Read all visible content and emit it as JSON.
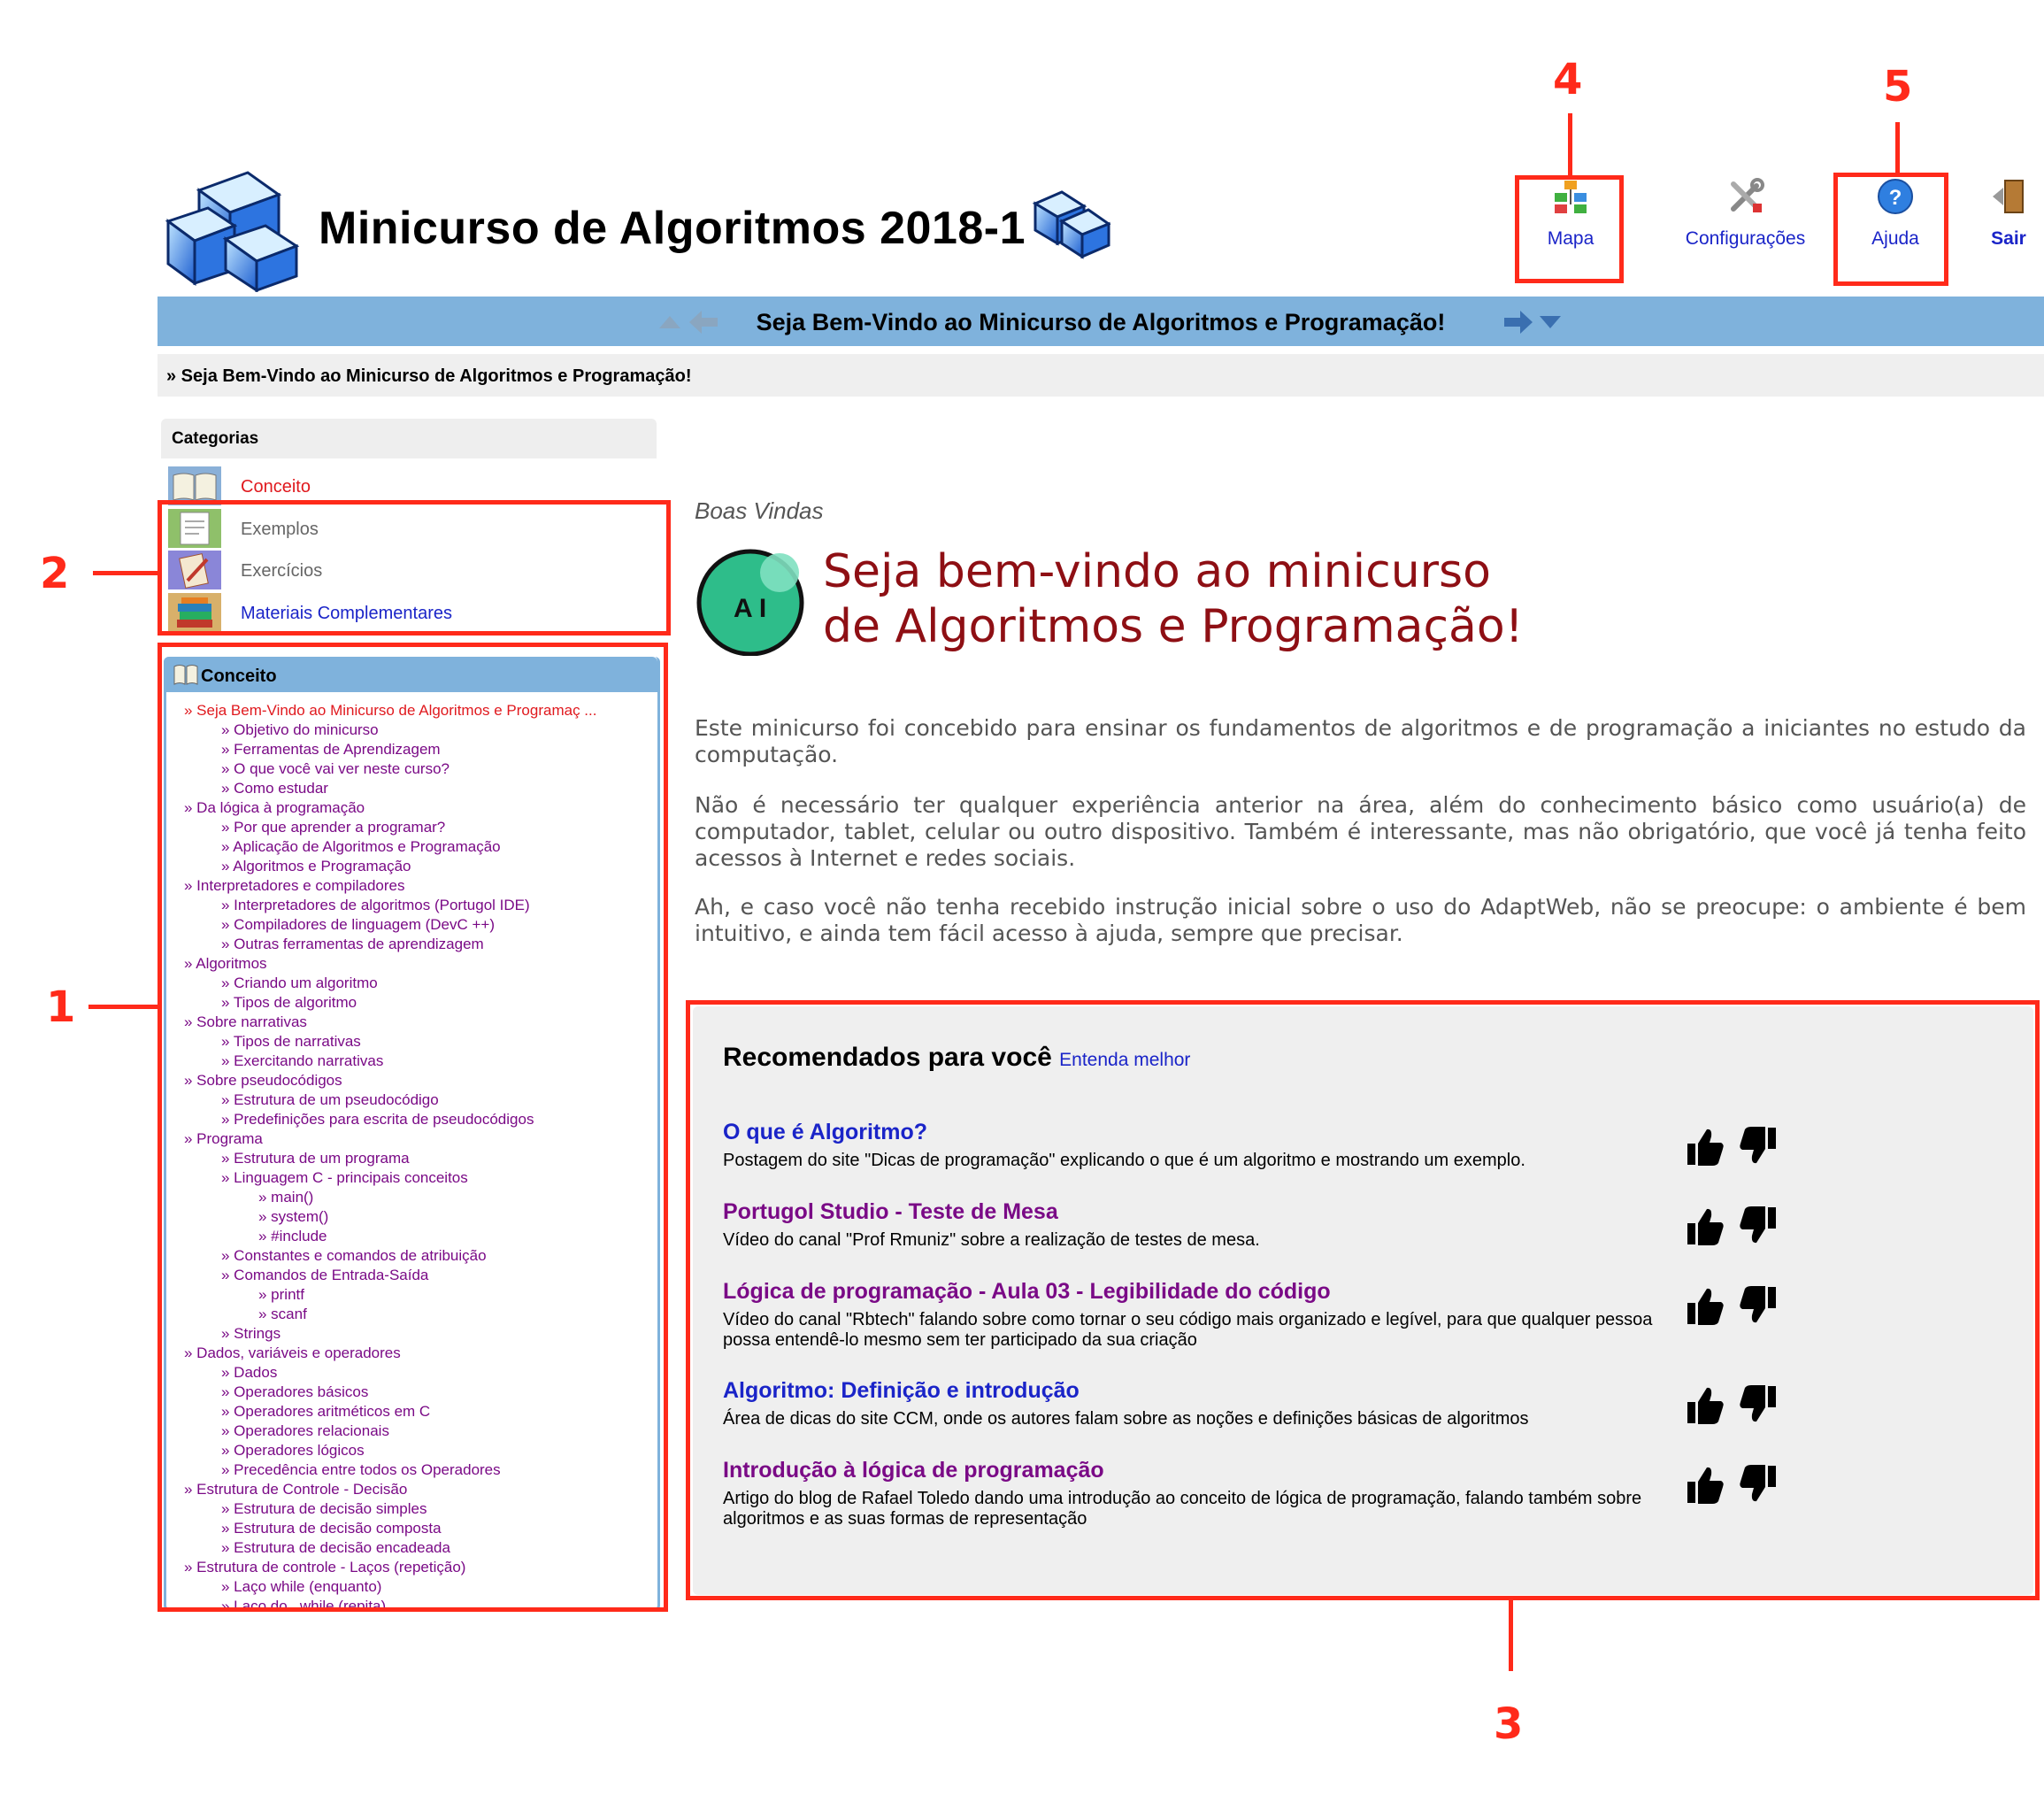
{
  "header": {
    "title": "Minicurso de Algoritmos 2018-1",
    "nav": [
      {
        "label": "Mapa",
        "icon": "sitemap-icon"
      },
      {
        "label": "Configurações",
        "icon": "tools-icon"
      },
      {
        "label": "Ajuda",
        "icon": "help-icon"
      },
      {
        "label": "Sair",
        "icon": "exit-door-icon"
      }
    ]
  },
  "banner": {
    "text": "Seja Bem-Vindo ao Minicurso de Algoritmos e Programação!",
    "breadcrumb": "» Seja Bem-Vindo ao Minicurso de Algoritmos e Programação!"
  },
  "categories": {
    "title": "Categorias",
    "items": [
      {
        "label": "Conceito",
        "color": "#e0191e"
      },
      {
        "label": "Exemplos",
        "color": "#666666"
      },
      {
        "label": "Exercícios",
        "color": "#666666"
      },
      {
        "label": "Materiais Complementares",
        "color": "#1a24c8"
      }
    ]
  },
  "tree": {
    "title": "Conceito",
    "items": [
      {
        "text": "» Seja Bem-Vindo ao Minicurso de Algoritmos e Programaç ...",
        "level": 0,
        "active": true
      },
      {
        "text": "» Objetivo do minicurso",
        "level": 1
      },
      {
        "text": "» Ferramentas de Aprendizagem",
        "level": 1
      },
      {
        "text": "» O que você vai ver neste curso?",
        "level": 1
      },
      {
        "text": "» Como estudar",
        "level": 1
      },
      {
        "text": "» Da lógica à programação",
        "level": 0
      },
      {
        "text": "» Por que aprender a programar?",
        "level": 1
      },
      {
        "text": "» Aplicação de Algoritmos e Programação",
        "level": 1
      },
      {
        "text": "» Algoritmos e Programação",
        "level": 1
      },
      {
        "text": "» Interpretadores e compiladores",
        "level": 0
      },
      {
        "text": "» Interpretadores de algoritmos (Portugol IDE)",
        "level": 1
      },
      {
        "text": "» Compiladores de linguagem (DevC ++)",
        "level": 1
      },
      {
        "text": "» Outras ferramentas de aprendizagem",
        "level": 1
      },
      {
        "text": "» Algoritmos",
        "level": 0
      },
      {
        "text": "» Criando um algoritmo",
        "level": 1
      },
      {
        "text": "» Tipos de algoritmo",
        "level": 1
      },
      {
        "text": "» Sobre narrativas",
        "level": 0
      },
      {
        "text": "» Tipos de narrativas",
        "level": 1
      },
      {
        "text": "» Exercitando narrativas",
        "level": 1
      },
      {
        "text": "» Sobre pseudocódigos",
        "level": 0
      },
      {
        "text": "» Estrutura de um pseudocódigo",
        "level": 1
      },
      {
        "text": "» Predefinições para escrita de pseudocódigos",
        "level": 1
      },
      {
        "text": "» Programa",
        "level": 0
      },
      {
        "text": "» Estrutura de um programa",
        "level": 1
      },
      {
        "text": "» Linguagem C - principais conceitos",
        "level": 1
      },
      {
        "text": "» main()",
        "level": 2
      },
      {
        "text": "» system()",
        "level": 2
      },
      {
        "text": "» #include",
        "level": 2
      },
      {
        "text": "» Constantes e comandos de atribuição",
        "level": 1
      },
      {
        "text": "» Comandos de Entrada-Saída",
        "level": 1
      },
      {
        "text": "» printf",
        "level": 2
      },
      {
        "text": "» scanf",
        "level": 2
      },
      {
        "text": "» Strings",
        "level": 1
      },
      {
        "text": "» Dados, variáveis e operadores",
        "level": 0
      },
      {
        "text": "» Dados",
        "level": 1
      },
      {
        "text": "» Operadores básicos",
        "level": 1
      },
      {
        "text": "» Operadores aritméticos em C",
        "level": 1
      },
      {
        "text": "» Operadores relacionais",
        "level": 1
      },
      {
        "text": "» Operadores lógicos",
        "level": 1
      },
      {
        "text": "» Precedência entre todos os Operadores",
        "level": 1
      },
      {
        "text": "» Estrutura de Controle - Decisão",
        "level": 0
      },
      {
        "text": "» Estrutura de decisão simples",
        "level": 1
      },
      {
        "text": "» Estrutura de decisão composta",
        "level": 1
      },
      {
        "text": "» Estrutura de decisão encadeada",
        "level": 1
      },
      {
        "text": "» Estrutura de controle - Laços (repetição)",
        "level": 0
      },
      {
        "text": "» Laço while (enquanto)",
        "level": 1
      },
      {
        "text": "» Laço do...while (repita)",
        "level": 1
      }
    ]
  },
  "main": {
    "section_label": "Boas Vindas",
    "logo_text": "A I",
    "welcome_line1": "Seja bem-vindo ao minicurso",
    "welcome_line2": "de Algoritmos e Programação!",
    "paragraphs": [
      "Este minicurso foi concebido para ensinar os fundamentos de algoritmos e de programação a iniciantes no estudo da computação.",
      "Não é necessário ter qualquer experiência anterior na área, além do conhecimento básico como usuário(a) de computador, tablet, celular ou outro dispositivo. Também é interessante, mas não obrigatório, que você já tenha feito acessos à Internet e redes sociais.",
      "Ah, e caso você não tenha recebido instrução inicial sobre o uso do AdaptWeb, não se preocupe: o ambiente é bem intuitivo, e ainda tem fácil acesso à ajuda, sempre que precisar."
    ]
  },
  "recommendations": {
    "title": "Recomendados para você",
    "more_link": "Entenda melhor",
    "items": [
      {
        "title": "O que é Algoritmo?",
        "title_color": "#1a24c8",
        "desc": "Postagem do site \"Dicas de programação\" explicando o que é um algoritmo e mostrando um exemplo."
      },
      {
        "title": "Portugol Studio - Teste de Mesa",
        "title_color": "#7a0a86",
        "desc": "Vídeo do canal \"Prof Rmuniz\" sobre a realização de testes de mesa."
      },
      {
        "title": "Lógica de programação - Aula 03 - Legibilidade do código",
        "title_color": "#7a0a86",
        "desc": "Vídeo do canal \"Rbtech\" falando sobre como tornar o seu código mais organizado e legível, para que qualquer pessoa possa entendê-lo mesmo sem ter participado da sua criação"
      },
      {
        "title": "Algoritmo: Definição e introdução",
        "title_color": "#1a24c8",
        "desc": "Área de dicas do site CCM, onde os autores falam sobre as noções e definições básicas de algoritmos"
      },
      {
        "title": "Introdução à lógica de programação",
        "title_color": "#7a0a86",
        "desc": "Artigo do blog de Rafael Toledo dando uma introdução ao conceito de lógica de programação, falando também sobre algoritmos e as suas formas de representação"
      }
    ]
  },
  "annotations": [
    "1",
    "2",
    "3",
    "4",
    "5"
  ]
}
